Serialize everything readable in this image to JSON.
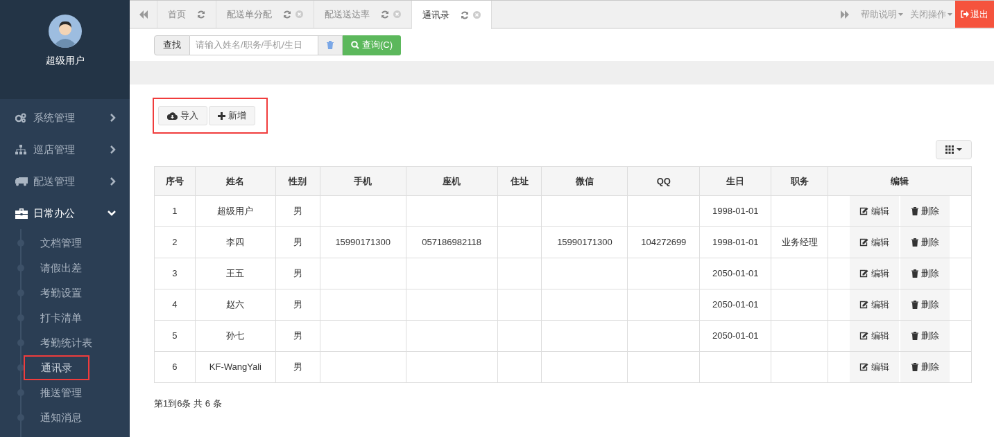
{
  "user": {
    "name": "超级用户"
  },
  "sidebar": {
    "items": [
      {
        "label": "系统管理",
        "expanded": false
      },
      {
        "label": "巡店管理",
        "expanded": false
      },
      {
        "label": "配送管理",
        "expanded": false
      },
      {
        "label": "日常办公",
        "expanded": true,
        "children": [
          {
            "label": "文档管理",
            "selected": false
          },
          {
            "label": "请假出差",
            "selected": false
          },
          {
            "label": "考勤设置",
            "selected": false
          },
          {
            "label": "打卡清单",
            "selected": false
          },
          {
            "label": "考勤统计表",
            "selected": false
          },
          {
            "label": "通讯录",
            "selected": true
          },
          {
            "label": "推送管理",
            "selected": false
          },
          {
            "label": "通知消息",
            "selected": false
          }
        ]
      }
    ]
  },
  "tabs": [
    {
      "label": "首页",
      "selected": false,
      "closable": false
    },
    {
      "label": "配送单分配",
      "selected": false,
      "closable": true
    },
    {
      "label": "配送送达率",
      "selected": false,
      "closable": true
    },
    {
      "label": "通讯录",
      "selected": true,
      "closable": true
    }
  ],
  "top_menu": [
    "帮助说明",
    "关闭操作"
  ],
  "logout": "退出",
  "search": {
    "label": "查找",
    "placeholder": "请输入姓名/职务/手机/生日",
    "button": "查询(C)"
  },
  "toolbar": {
    "highlighted": true,
    "buttons": [
      "导入",
      "新增"
    ]
  },
  "table": {
    "columns": [
      "序号",
      "姓名",
      "性别",
      "手机",
      "座机",
      "住址",
      "微信",
      "QQ",
      "生日",
      "职务",
      "编辑"
    ],
    "rows": [
      {
        "cells": [
          "1",
          "超级用户",
          "男",
          "",
          "",
          "",
          "",
          "",
          "1998-01-01",
          ""
        ],
        "actions": [
          "编辑",
          "删除"
        ]
      },
      {
        "cells": [
          "2",
          "李四",
          "男",
          "15990171300",
          "057186982118",
          "",
          "15990171300",
          "104272699",
          "1998-01-01",
          "业务经理"
        ],
        "actions": [
          "编辑",
          "删除"
        ]
      },
      {
        "cells": [
          "3",
          "王五",
          "男",
          "",
          "",
          "",
          "",
          "",
          "2050-01-01",
          ""
        ],
        "actions": [
          "编辑",
          "删除"
        ]
      },
      {
        "cells": [
          "4",
          "赵六",
          "男",
          "",
          "",
          "",
          "",
          "",
          "2050-01-01",
          ""
        ],
        "actions": [
          "编辑",
          "删除"
        ]
      },
      {
        "cells": [
          "5",
          "孙七",
          "男",
          "",
          "",
          "",
          "",
          "",
          "2050-01-01",
          ""
        ],
        "actions": [
          "编辑",
          "删除"
        ]
      },
      {
        "cells": [
          "6",
          "KF-WangYali",
          "男",
          "",
          "",
          "",
          "",
          "",
          "",
          ""
        ],
        "actions": [
          "编辑",
          "删除"
        ]
      }
    ]
  },
  "pagination": "第1到6条 共 6 条"
}
